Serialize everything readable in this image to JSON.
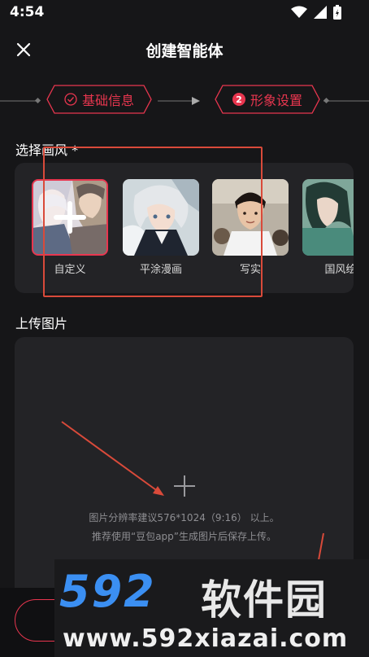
{
  "status_bar": {
    "time": "4:54"
  },
  "header": {
    "title": "创建智能体",
    "close_icon": "close-icon"
  },
  "stepper": {
    "steps": [
      {
        "label": "基础信息",
        "state": "done"
      },
      {
        "number": "2",
        "label": "形象设置",
        "state": "active"
      }
    ]
  },
  "style_section": {
    "label": "选择画风 *",
    "items": [
      {
        "label": "自定义",
        "selected": true
      },
      {
        "label": "平涂漫画",
        "selected": false
      },
      {
        "label": "写实",
        "selected": false
      },
      {
        "label": "国风绘",
        "selected": false
      }
    ]
  },
  "upload_section": {
    "label": "上传图片",
    "hint_line1": "图片分辨率建议576*1024（9:16） 以上。",
    "hint_line2": "推荐使用“豆包app”生成图片后保存上传。"
  },
  "watermark": {
    "logo": "592",
    "cn": "软件园",
    "url": "www.592xiazai.com"
  },
  "colors": {
    "accent": "#e8364f",
    "panel": "#232326",
    "background": "#161618",
    "annotation": "#d94a3a",
    "watermark_blue": "#3b8ff2"
  }
}
